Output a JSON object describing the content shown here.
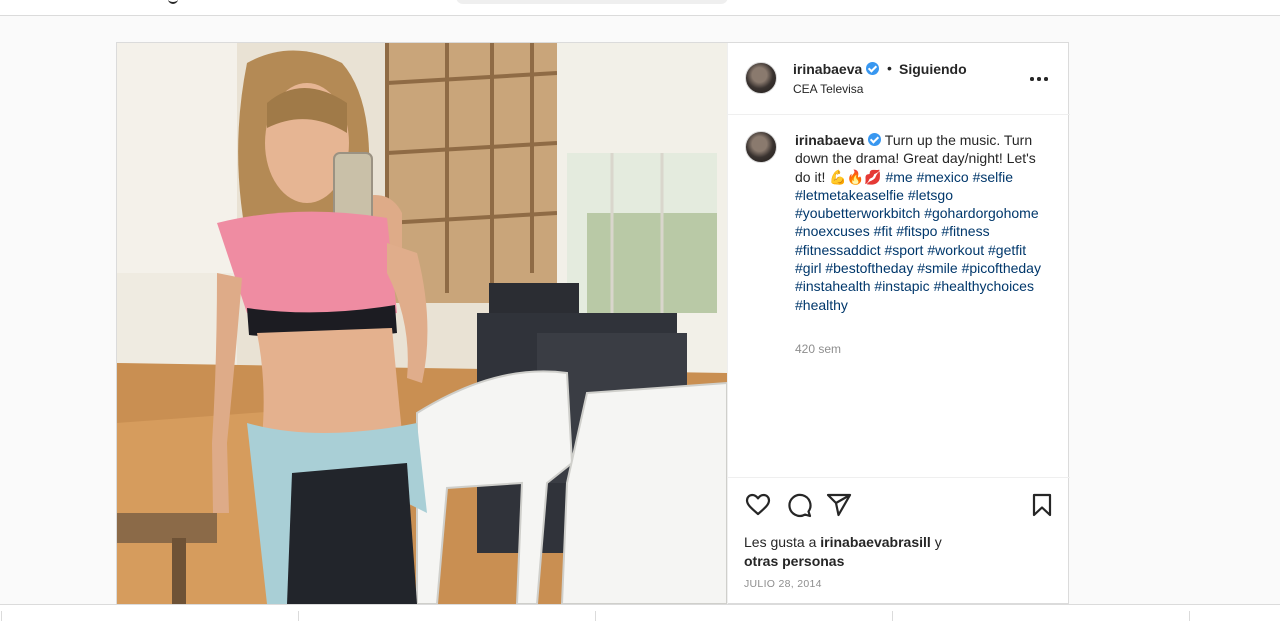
{
  "post": {
    "username": "irinabaeva",
    "follow_label": "Siguiendo",
    "location": "CEA Televisa",
    "caption": {
      "username": "irinabaeva",
      "text": "Turn up the music. Turn down the drama! Great day/night! Let's do it! 💪🔥💋",
      "hashtags": [
        "#me",
        "#mexico",
        "#selfie",
        "#letmetakeaselfie",
        "#letsgo",
        "#youbetterworkbitch",
        "#gohardorgohome",
        "#noexcuses",
        "#fit",
        "#fitspo",
        "#fitness",
        "#fitnessaddict",
        "#sport",
        "#workout",
        "#getfit",
        "#girl",
        "#bestoftheday",
        "#smile",
        "#picoftheday",
        "#instahealth",
        "#instapic",
        "#healthychoices",
        "#healthy"
      ],
      "time": "420 sem"
    },
    "likes": {
      "prefix": "Les gusta a",
      "liker": "irinabaevabrasill",
      "joiner": "y",
      "others": "otras personas"
    },
    "date": "JULIO 28, 2014"
  },
  "icons": {
    "like": "heart-icon",
    "comment": "comment-icon",
    "share": "share-icon",
    "save": "bookmark-icon",
    "more": "more-options-icon",
    "verified": "verified-badge-icon"
  },
  "colors": {
    "hashtag": "#00376b",
    "verified": "#3897f0",
    "muted": "#8e8e8e",
    "border": "#dbdbdb"
  }
}
